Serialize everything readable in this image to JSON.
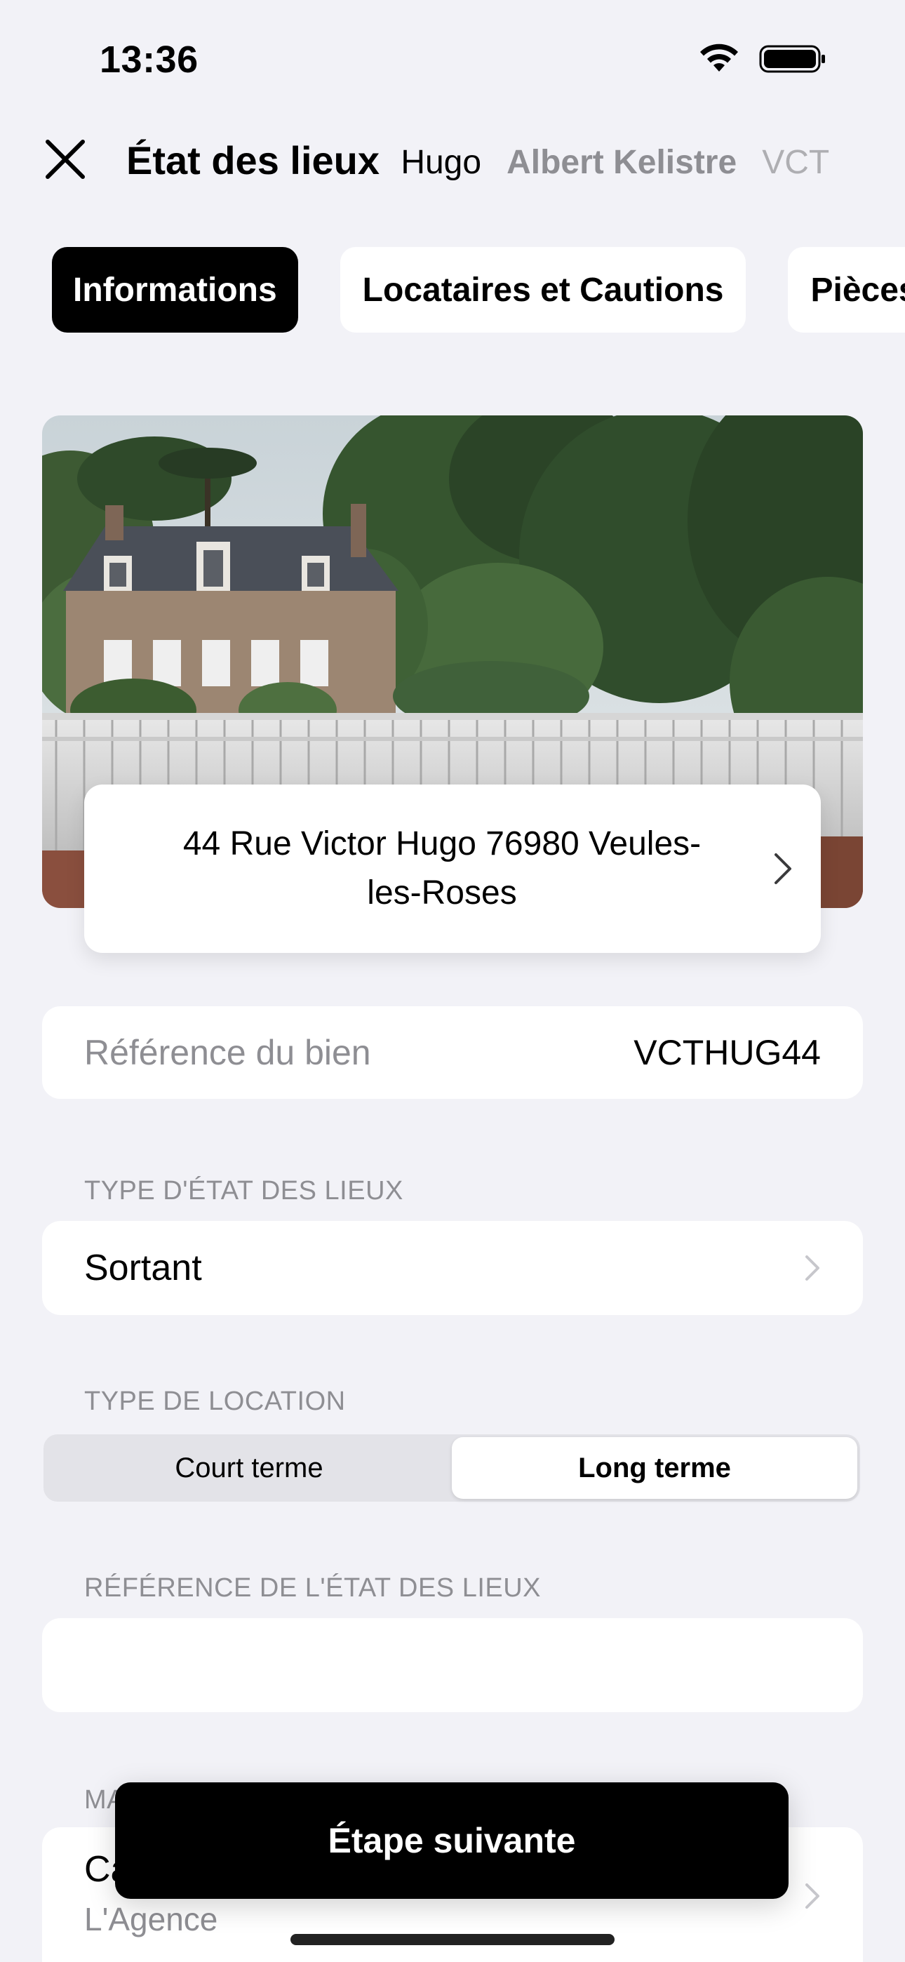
{
  "status_bar": {
    "time": "13:36"
  },
  "header": {
    "title": "État des lieux",
    "ticker": [
      "r Hugo",
      "Albert Kelistre",
      "VCT"
    ]
  },
  "tabs": [
    {
      "label": "Informations",
      "active": true
    },
    {
      "label": "Locataires et Cautions",
      "active": false
    },
    {
      "label": "Pièces",
      "active": false
    }
  ],
  "property": {
    "address": "44 Rue Victor Hugo 76980 Veules-les-Roses",
    "reference_label": "Référence du bien",
    "reference_value": "VCTHUG44"
  },
  "inventory_type": {
    "section_label": "TYPE D'ÉTAT DES LIEUX",
    "value": "Sortant"
  },
  "rental_type": {
    "section_label": "TYPE DE LOCATION",
    "options": [
      "Court terme",
      "Long terme"
    ],
    "selected": "Long terme"
  },
  "inventory_reference": {
    "section_label": "RÉFÉRENCE DE L'ÉTAT DES LIEUX",
    "value": ""
  },
  "mandate": {
    "section_label": "MA",
    "value": "Ca",
    "sub": "L'Agence"
  },
  "next_button": {
    "label": "Étape suivante"
  },
  "colors": {
    "accent": "#000000",
    "background": "#f2f2f7",
    "secondary_text": "#8e8e93"
  }
}
